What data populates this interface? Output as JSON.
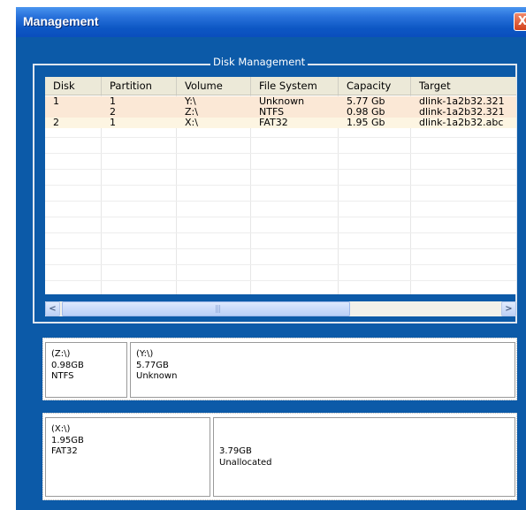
{
  "window": {
    "title": "Management",
    "close_glyph": "X"
  },
  "disk_management": {
    "legend": "Disk Management",
    "columns": [
      "Disk",
      "Partition",
      "Volume",
      "File System",
      "Capacity",
      "Target"
    ],
    "rows": [
      {
        "disk": "1",
        "partition": "1",
        "volume": "Y:\\",
        "file_system": "Unknown",
        "capacity": "5.77 Gb",
        "target": "dlink-1a2b32.321",
        "highlight": "#fbe8d6"
      },
      {
        "disk": "",
        "partition": "2",
        "volume": "Z:\\",
        "file_system": "NTFS",
        "capacity": "0.98 Gb",
        "target": "dlink-1a2b32.321",
        "highlight": "#fbe8d6"
      },
      {
        "disk": "2",
        "partition": "1",
        "volume": "X:\\",
        "file_system": "FAT32",
        "capacity": "1.95 Gb",
        "target": "dlink-1a2b32.abc",
        "highlight": "#fdf5e2"
      }
    ],
    "scrollbar": {
      "left_glyph": "<",
      "right_glyph": ">",
      "grip": "|||"
    }
  },
  "disk1_map": {
    "partitions": [
      {
        "volume": "(Z:\\)",
        "size": "0.98GB",
        "fs": "NTFS"
      },
      {
        "volume": "(Y:\\)",
        "size": "5.77GB",
        "fs": "Unknown"
      }
    ]
  },
  "disk2_map": {
    "partitions": [
      {
        "volume": "(X:\\)",
        "size": "1.95GB",
        "fs": "FAT32"
      },
      {
        "volume": "",
        "size": "3.79GB",
        "fs": "Unallocated"
      }
    ]
  },
  "colors": {
    "window_frame": "#0b55a8",
    "titlebar": "#0d57c4",
    "close_button": "#d2401a",
    "row_highlight": "#fbe8d6",
    "row_highlight_alt": "#fdf5e2"
  }
}
